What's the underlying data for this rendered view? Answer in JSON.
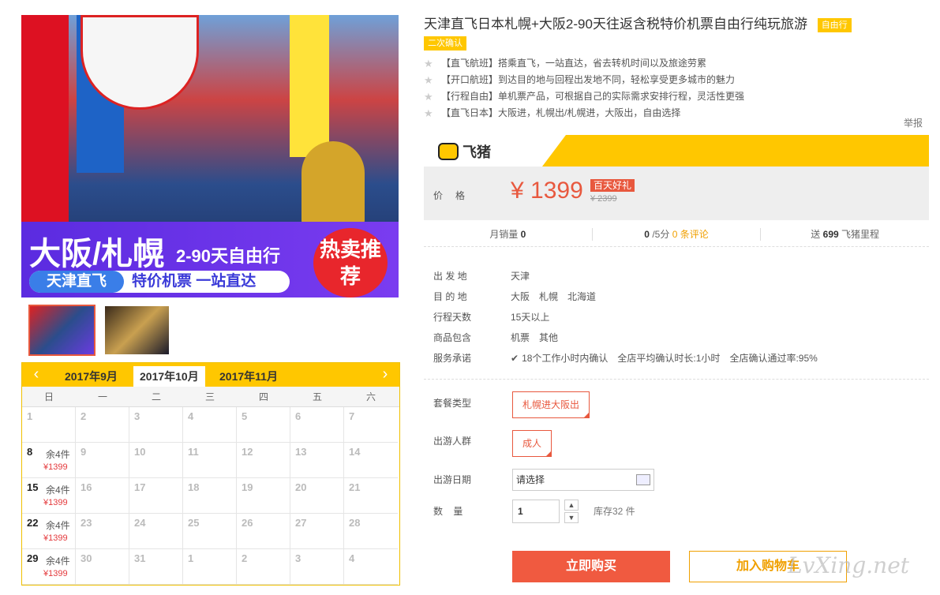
{
  "product": {
    "title": "天津直飞日本札幌+大阪2-90天往返含税特价机票自由行纯玩旅游",
    "tag_free": "自由行",
    "tag_confirm": "二次确认",
    "features": [
      "【直飞航班】搭乘直飞，一站直达，省去转机时间以及旅途劳累",
      "【开口航班】到达目的地与回程出发地不同，轻松享受更多城市的魅力",
      "【行程自由】单机票产品，可根据自己的实际需求安排行程，灵活性更强",
      "【直飞日本】大阪进，札幌出/札幌进，大阪出，自由选择"
    ],
    "report": "举报"
  },
  "hero": {
    "title": "大阪/札幌",
    "subtitle": "2-90天自由行",
    "strip_a": "天津直飞",
    "strip_b": "特价机票 一站直达",
    "badge": "热卖推荐"
  },
  "brand": {
    "name": "飞猪"
  },
  "price": {
    "label": "价格",
    "value": "¥ 1399",
    "gift": "百天好礼",
    "original": "¥ 2399"
  },
  "stats": {
    "sales_label": "月销量",
    "sales": "0",
    "score": "0",
    "score_suffix": "/5分",
    "reviews": "0 条评论",
    "miles_prefix": "送",
    "miles": "699",
    "miles_suffix": "飞猪里程"
  },
  "info": {
    "depart_k": "出 发 地",
    "depart_v": "天津",
    "dest_k": "目 的 地",
    "dest_v": [
      "大阪",
      "札幌",
      "北海道"
    ],
    "days_k": "行程天数",
    "days_v": "15天以上",
    "incl_k": "商品包含",
    "incl_v": [
      "机票",
      "其他"
    ],
    "svc_k": "服务承诺",
    "svc_v": [
      "18个工作小时内确认",
      "全店平均确认时长:1小时",
      "全店确认通过率:95%"
    ]
  },
  "options": {
    "package_k": "套餐类型",
    "package_v": "札幌进大阪出",
    "crowd_k": "出游人群",
    "crowd_v": "成人",
    "date_k": "出游日期",
    "date_placeholder": "请选择",
    "qty_k": "数    量",
    "qty_v": "1",
    "stock": "库存32 件"
  },
  "actions": {
    "buy": "立即购买",
    "cart": "加入购物车"
  },
  "calendar": {
    "months": [
      "2017年9月",
      "2017年10月",
      "2017年11月"
    ],
    "weekdays": [
      "日",
      "一",
      "二",
      "三",
      "四",
      "五",
      "六"
    ],
    "rows": [
      [
        {
          "d": "1"
        },
        {
          "d": "2"
        },
        {
          "d": "3"
        },
        {
          "d": "4"
        },
        {
          "d": "5"
        },
        {
          "d": "6"
        },
        {
          "d": "7"
        }
      ],
      [
        {
          "d": "8",
          "s": "余4件",
          "p": "¥1399"
        },
        {
          "d": "9"
        },
        {
          "d": "10"
        },
        {
          "d": "11"
        },
        {
          "d": "12"
        },
        {
          "d": "13"
        },
        {
          "d": "14"
        }
      ],
      [
        {
          "d": "15",
          "s": "余4件",
          "p": "¥1399"
        },
        {
          "d": "16"
        },
        {
          "d": "17"
        },
        {
          "d": "18"
        },
        {
          "d": "19"
        },
        {
          "d": "20"
        },
        {
          "d": "21"
        }
      ],
      [
        {
          "d": "22",
          "s": "余4件",
          "p": "¥1399"
        },
        {
          "d": "23"
        },
        {
          "d": "24"
        },
        {
          "d": "25"
        },
        {
          "d": "26"
        },
        {
          "d": "27"
        },
        {
          "d": "28"
        }
      ],
      [
        {
          "d": "29",
          "s": "余4件",
          "p": "¥1399"
        },
        {
          "d": "30"
        },
        {
          "d": "31"
        },
        {
          "d": "1"
        },
        {
          "d": "2"
        },
        {
          "d": "3"
        },
        {
          "d": "4"
        }
      ]
    ]
  },
  "watermark": "LvXing.net"
}
